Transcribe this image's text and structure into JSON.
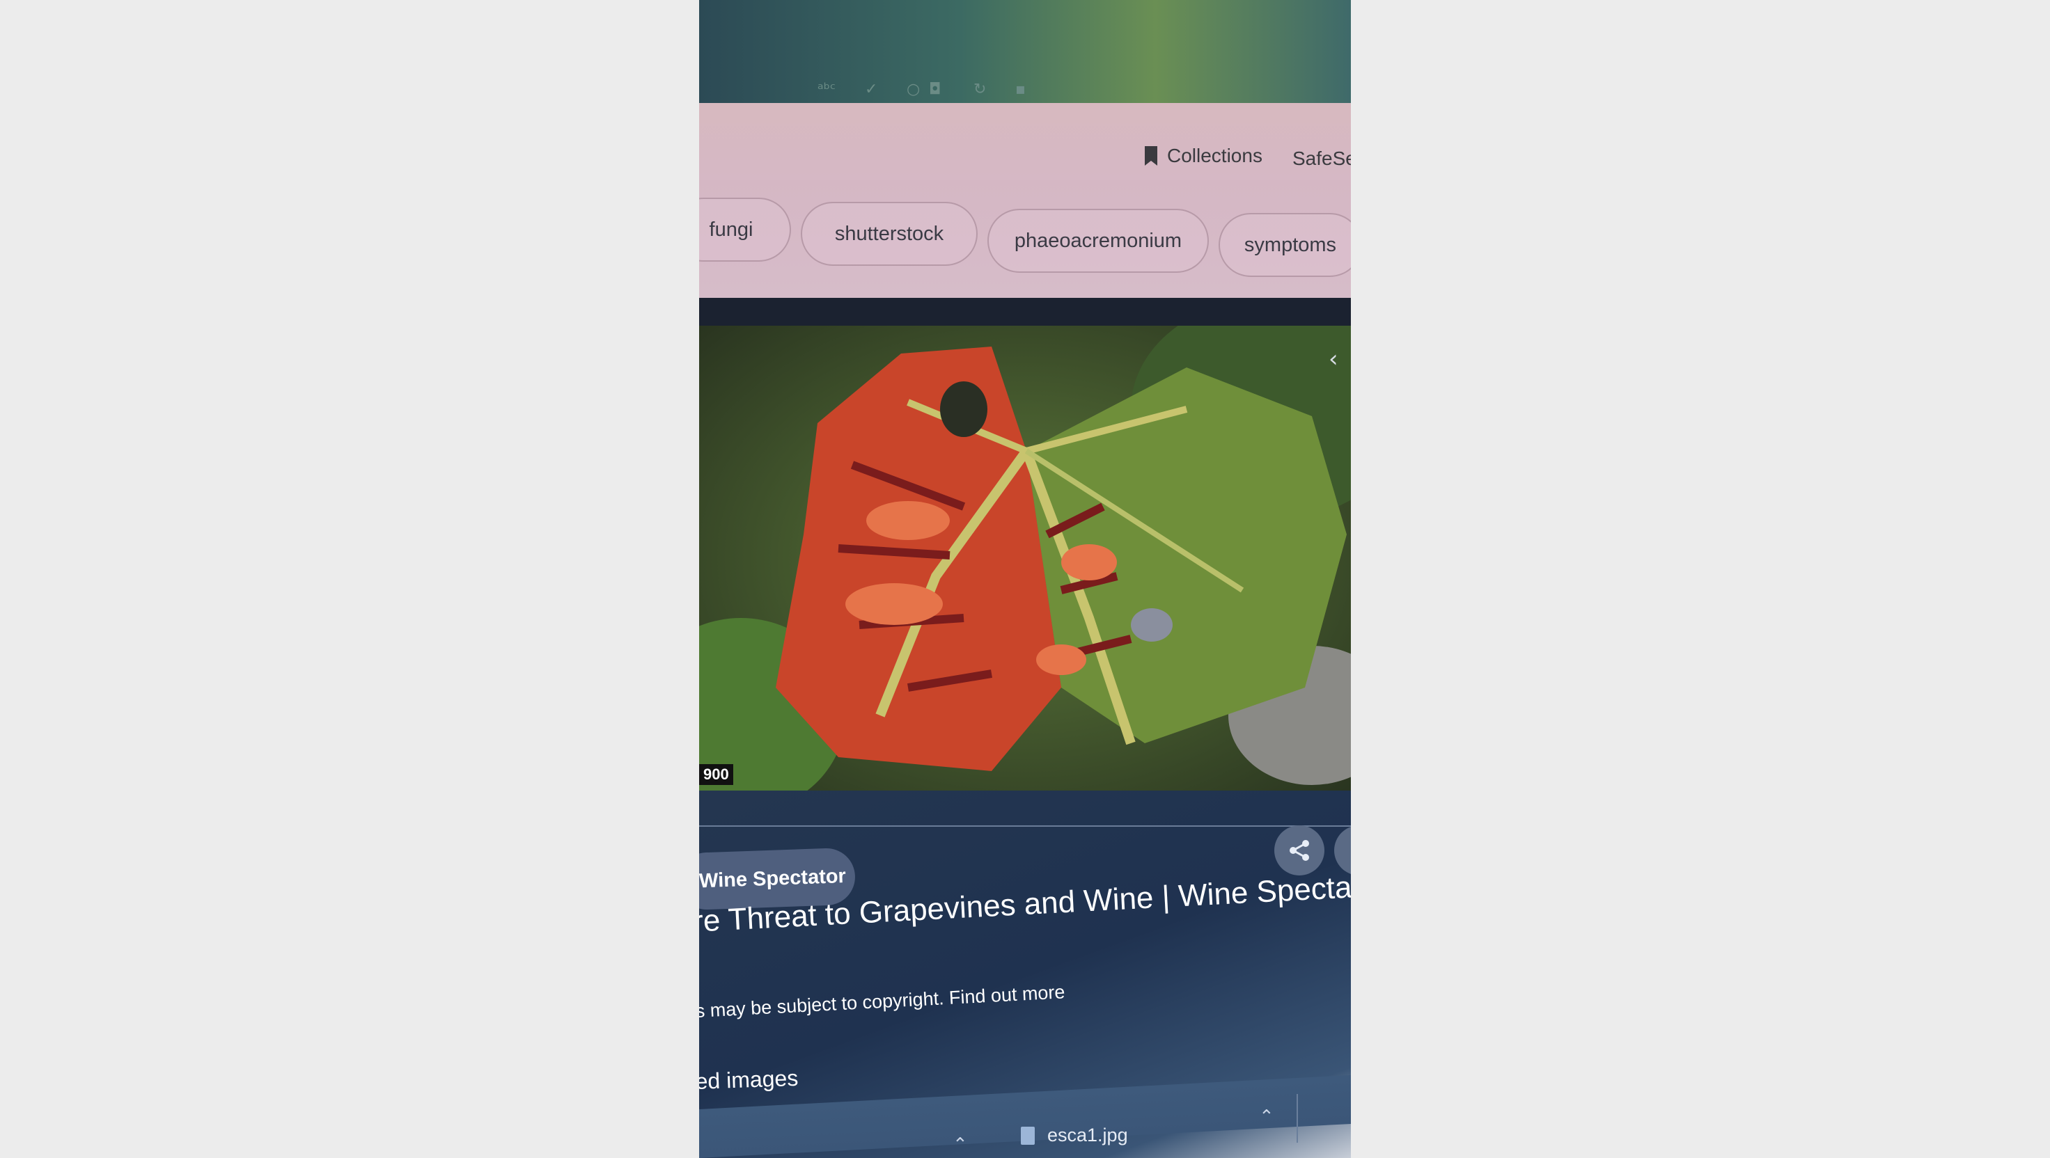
{
  "toolbar": {
    "icons": [
      "abc-check-icon",
      "check-icon",
      "circle-icon",
      "pocket-icon",
      "refresh-icon",
      "extension-icon"
    ]
  },
  "header": {
    "collections_label": "Collections",
    "safesearch_label": "SafeSe"
  },
  "chips": [
    {
      "label": "fungi"
    },
    {
      "label": "shutterstock"
    },
    {
      "label": "phaeoacremonium"
    },
    {
      "label": "symptoms"
    }
  ],
  "preview": {
    "resolution_text": "900",
    "chevron": "‹"
  },
  "result": {
    "source": "Wine Spectator",
    "title": "re Threat to Grapevines and Wine | Wine Spectat",
    "copyright": "s may be subject to copyright. Find out more",
    "related": "ed images"
  },
  "downloads": {
    "filename": "esca1.jpg"
  },
  "colors": {
    "leaf_red": "#c9452a",
    "leaf_green": "#6f8f3a",
    "panel_bg": "#243650",
    "chip_bg": "#d6bcc9"
  }
}
